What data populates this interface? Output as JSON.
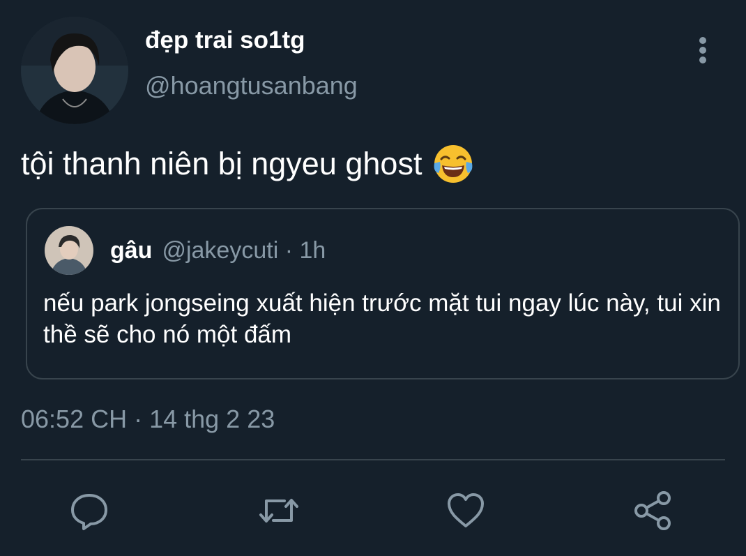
{
  "tweet": {
    "author": {
      "display_name": "đẹp trai so1tg",
      "handle": "@hoangtusanbang",
      "avatar": "profile-photo"
    },
    "more_icon": "vertical-ellipsis-icon",
    "text": "tội thanh niên bị ngyeu ghost",
    "emoji": "face-with-tears-of-joy",
    "quoted": {
      "display_name": "gâu",
      "meta": "@jakeycuti · 1h",
      "avatar": "profile-photo",
      "text": "nếu park jongseing xuất hiện trước mặt tui ngay lúc này, tui xin thề sẽ cho nó một đấm"
    },
    "timestamp": "06:52 CH · 14 thg 2 23",
    "actions": [
      "reply-icon",
      "retweet-icon",
      "like-icon",
      "share-icon"
    ]
  },
  "colors": {
    "background": "#15202b",
    "text_primary": "#ffffff",
    "text_secondary": "#8899a6",
    "border": "#38444d"
  }
}
